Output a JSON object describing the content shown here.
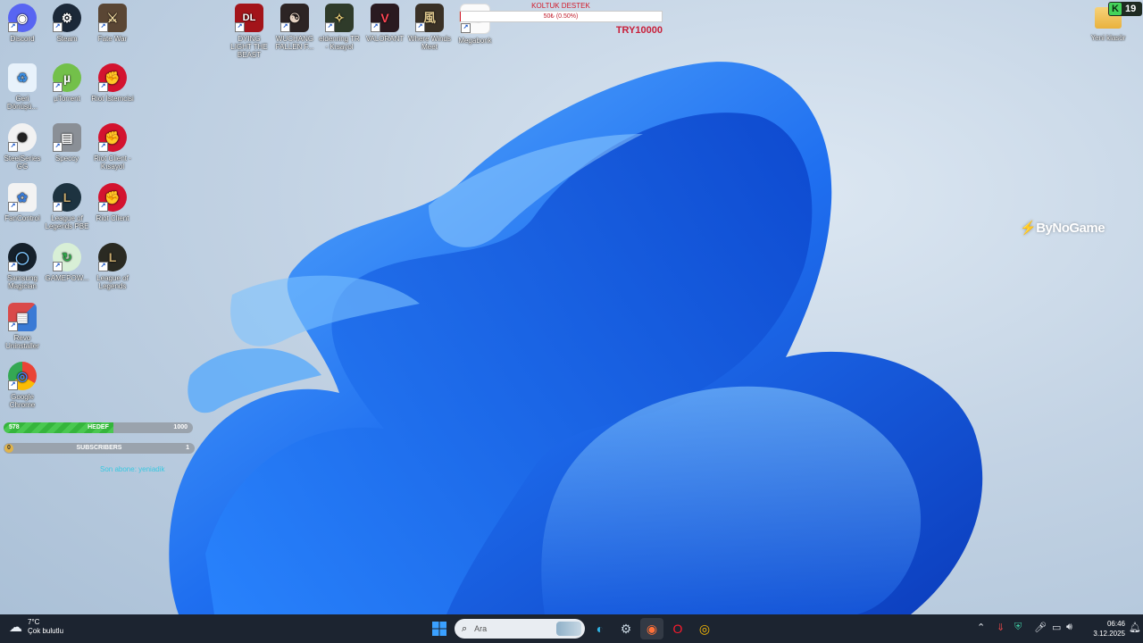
{
  "desktop_icons": [
    {
      "label": "Discord",
      "icon": "discord-icon",
      "color": "#5865f2",
      "glyph": "◉"
    },
    {
      "label": "Steam",
      "icon": "steam-icon",
      "color": "#1b2838",
      "glyph": "⚙"
    },
    {
      "label": "Fate War",
      "icon": "game-icon",
      "color": "#5a4634",
      "glyph": "⚔"
    },
    {
      "label": "Geri Dönüşü...",
      "icon": "recycle-bin-icon",
      "color": "#e8f2fb",
      "glyph": "♻"
    },
    {
      "label": "µTorrent",
      "icon": "utorrent-icon",
      "color": "#73c04a",
      "glyph": "µ"
    },
    {
      "label": "Riot İstemcisi",
      "icon": "riot-icon",
      "color": "#d3132f",
      "glyph": "✊"
    },
    {
      "label": "SteelSeries GG",
      "icon": "steelseries-icon",
      "color": "#f2f2f2",
      "glyph": "✺"
    },
    {
      "label": "Speccy",
      "icon": "speccy-icon",
      "color": "#8a8f96",
      "glyph": "▤"
    },
    {
      "label": "Riot Client - Kısayol",
      "icon": "riot-icon",
      "color": "#d3132f",
      "glyph": "✊"
    },
    {
      "label": "FanControl",
      "icon": "fan-icon",
      "color": "#f3f3f3",
      "glyph": "✿"
    },
    {
      "label": "League of Legends PBE",
      "icon": "league-icon",
      "color": "#1d3340",
      "glyph": "L"
    },
    {
      "label": "Riot Client",
      "icon": "riot-icon",
      "color": "#d3132f",
      "glyph": "✊"
    },
    {
      "label": "Samsung Magician",
      "icon": "samsung-magician-icon",
      "color": "#15202b",
      "glyph": "◯"
    },
    {
      "label": "GAMEPOW...",
      "icon": "gamepower-icon",
      "color": "#d8efd6",
      "glyph": "↻"
    },
    {
      "label": "League of Legends",
      "icon": "league-icon",
      "color": "#2a2a22",
      "glyph": "L"
    },
    {
      "label": "Revo Uninstaller",
      "icon": "revo-uninstaller-icon",
      "color": "#d94a4a",
      "glyph": "▦"
    },
    {
      "label": "Google Chrome",
      "icon": "chrome-icon",
      "color": "#ffffff",
      "glyph": "◎"
    },
    {
      "label": "DYING LIGHT THE BEAST",
      "icon": "dying-light-icon",
      "color": "#a3141a",
      "glyph": "DL"
    },
    {
      "label": "WUCHANG FALLEN F...",
      "icon": "wuchang-icon",
      "color": "#2c2424",
      "glyph": "☯"
    },
    {
      "label": "eldenring TR - Kısayol",
      "icon": "elden-ring-icon",
      "color": "#2f3b2a",
      "glyph": "✧"
    },
    {
      "label": "VALORANT",
      "icon": "valorant-icon",
      "color": "#2a1a20",
      "glyph": "V"
    },
    {
      "label": "Where Winds Meet",
      "icon": "where-winds-meet-icon",
      "color": "#3a3126",
      "glyph": "風"
    },
    {
      "label": "Megabonk",
      "icon": "megabonk-icon",
      "color": "#fbfbfb",
      "glyph": "MB"
    },
    {
      "label": "Yeni klasör",
      "icon": "folder-icon",
      "color": "#f2c14e",
      "glyph": "▭"
    }
  ],
  "koltuk": {
    "title": "KOLTUK DESTEK",
    "progress_text": "50₺ (0.50%)",
    "progress": 0.005,
    "goal": "TRY10000"
  },
  "hedef": {
    "current": "578",
    "label": "HEDEF",
    "target": "1000",
    "progress": 0.578
  },
  "subscribers": {
    "current": "0",
    "label": "SUBSCRIBERS",
    "target": "1"
  },
  "ticker": "Son abone: yeniadik",
  "bynogame": "ByNoGame",
  "kick_badge": {
    "letter": "K",
    "count": "19"
  },
  "taskbar": {
    "weather": {
      "temp": "7°C",
      "condition": "Çok bulutlu"
    },
    "search_placeholder": "Ara",
    "clock": {
      "time": "06:46",
      "date": "3.12.2025"
    }
  }
}
